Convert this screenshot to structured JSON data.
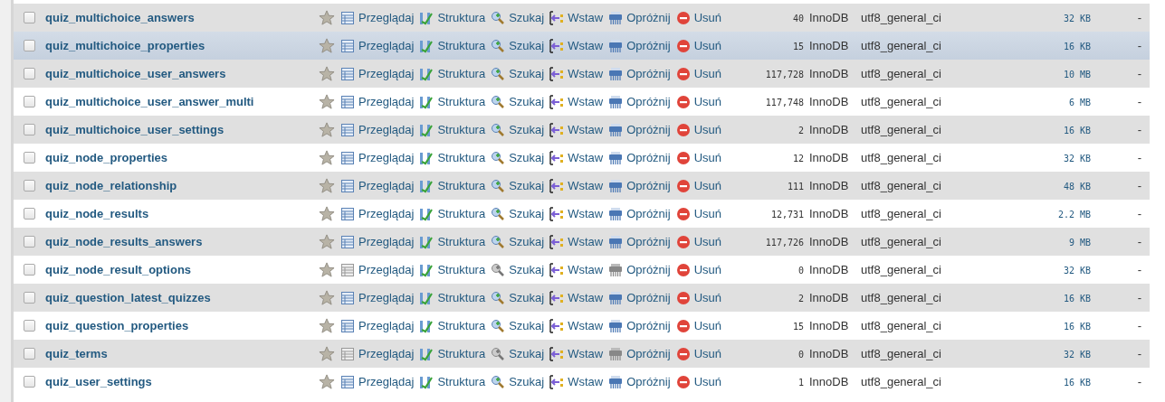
{
  "rows": [
    {
      "name": "quiz_multichoice_answers",
      "checked": false,
      "highlighted": false,
      "actions": [
        {
          "kind": "browse",
          "label": "Przeglądaj",
          "disabled": false
        },
        {
          "kind": "structure",
          "label": "Struktura",
          "disabled": false
        },
        {
          "kind": "search",
          "label": "Szukaj",
          "disabled": false
        },
        {
          "kind": "insert",
          "label": "Wstaw",
          "disabled": false
        },
        {
          "kind": "empty",
          "label": "Opróżnij",
          "disabled": false
        },
        {
          "kind": "drop",
          "label": "Usuń",
          "disabled": false
        }
      ],
      "row_count": "40",
      "engine": "InnoDB",
      "collation": "utf8_general_ci",
      "size": "32",
      "size_unit": "KB",
      "overhead": "-"
    },
    {
      "name": "quiz_multichoice_properties",
      "checked": false,
      "highlighted": true,
      "actions": [
        {
          "kind": "browse",
          "label": "Przeglądaj",
          "disabled": false
        },
        {
          "kind": "structure",
          "label": "Struktura",
          "disabled": false
        },
        {
          "kind": "search",
          "label": "Szukaj",
          "disabled": false
        },
        {
          "kind": "insert",
          "label": "Wstaw",
          "disabled": false
        },
        {
          "kind": "empty",
          "label": "Opróżnij",
          "disabled": false
        },
        {
          "kind": "drop",
          "label": "Usuń",
          "disabled": false
        }
      ],
      "row_count": "15",
      "engine": "InnoDB",
      "collation": "utf8_general_ci",
      "size": "16",
      "size_unit": "KB",
      "overhead": "-"
    },
    {
      "name": "quiz_multichoice_user_answers",
      "checked": false,
      "highlighted": false,
      "actions": [
        {
          "kind": "browse",
          "label": "Przeglądaj",
          "disabled": false
        },
        {
          "kind": "structure",
          "label": "Struktura",
          "disabled": false
        },
        {
          "kind": "search",
          "label": "Szukaj",
          "disabled": false
        },
        {
          "kind": "insert",
          "label": "Wstaw",
          "disabled": false
        },
        {
          "kind": "empty",
          "label": "Opróżnij",
          "disabled": false
        },
        {
          "kind": "drop",
          "label": "Usuń",
          "disabled": false
        }
      ],
      "row_count": "117,728",
      "engine": "InnoDB",
      "collation": "utf8_general_ci",
      "size": "10",
      "size_unit": "MB",
      "overhead": "-"
    },
    {
      "name": "quiz_multichoice_user_answer_multi",
      "checked": false,
      "highlighted": false,
      "actions": [
        {
          "kind": "browse",
          "label": "Przeglądaj",
          "disabled": false
        },
        {
          "kind": "structure",
          "label": "Struktura",
          "disabled": false
        },
        {
          "kind": "search",
          "label": "Szukaj",
          "disabled": false
        },
        {
          "kind": "insert",
          "label": "Wstaw",
          "disabled": false
        },
        {
          "kind": "empty",
          "label": "Opróżnij",
          "disabled": false
        },
        {
          "kind": "drop",
          "label": "Usuń",
          "disabled": false
        }
      ],
      "row_count": "117,748",
      "engine": "InnoDB",
      "collation": "utf8_general_ci",
      "size": "6",
      "size_unit": "MB",
      "overhead": "-"
    },
    {
      "name": "quiz_multichoice_user_settings",
      "checked": false,
      "highlighted": false,
      "actions": [
        {
          "kind": "browse",
          "label": "Przeglądaj",
          "disabled": false
        },
        {
          "kind": "structure",
          "label": "Struktura",
          "disabled": false
        },
        {
          "kind": "search",
          "label": "Szukaj",
          "disabled": false
        },
        {
          "kind": "insert",
          "label": "Wstaw",
          "disabled": false
        },
        {
          "kind": "empty",
          "label": "Opróżnij",
          "disabled": false
        },
        {
          "kind": "drop",
          "label": "Usuń",
          "disabled": false
        }
      ],
      "row_count": "2",
      "engine": "InnoDB",
      "collation": "utf8_general_ci",
      "size": "16",
      "size_unit": "KB",
      "overhead": "-"
    },
    {
      "name": "quiz_node_properties",
      "checked": false,
      "highlighted": false,
      "actions": [
        {
          "kind": "browse",
          "label": "Przeglądaj",
          "disabled": false
        },
        {
          "kind": "structure",
          "label": "Struktura",
          "disabled": false
        },
        {
          "kind": "search",
          "label": "Szukaj",
          "disabled": false
        },
        {
          "kind": "insert",
          "label": "Wstaw",
          "disabled": false
        },
        {
          "kind": "empty",
          "label": "Opróżnij",
          "disabled": false
        },
        {
          "kind": "drop",
          "label": "Usuń",
          "disabled": false
        }
      ],
      "row_count": "12",
      "engine": "InnoDB",
      "collation": "utf8_general_ci",
      "size": "32",
      "size_unit": "KB",
      "overhead": "-"
    },
    {
      "name": "quiz_node_relationship",
      "checked": false,
      "highlighted": false,
      "actions": [
        {
          "kind": "browse",
          "label": "Przeglądaj",
          "disabled": false
        },
        {
          "kind": "structure",
          "label": "Struktura",
          "disabled": false
        },
        {
          "kind": "search",
          "label": "Szukaj",
          "disabled": false
        },
        {
          "kind": "insert",
          "label": "Wstaw",
          "disabled": false
        },
        {
          "kind": "empty",
          "label": "Opróżnij",
          "disabled": false
        },
        {
          "kind": "drop",
          "label": "Usuń",
          "disabled": false
        }
      ],
      "row_count": "111",
      "engine": "InnoDB",
      "collation": "utf8_general_ci",
      "size": "48",
      "size_unit": "KB",
      "overhead": "-"
    },
    {
      "name": "quiz_node_results",
      "checked": false,
      "highlighted": false,
      "actions": [
        {
          "kind": "browse",
          "label": "Przeglądaj",
          "disabled": false
        },
        {
          "kind": "structure",
          "label": "Struktura",
          "disabled": false
        },
        {
          "kind": "search",
          "label": "Szukaj",
          "disabled": false
        },
        {
          "kind": "insert",
          "label": "Wstaw",
          "disabled": false
        },
        {
          "kind": "empty",
          "label": "Opróżnij",
          "disabled": false
        },
        {
          "kind": "drop",
          "label": "Usuń",
          "disabled": false
        }
      ],
      "row_count": "12,731",
      "engine": "InnoDB",
      "collation": "utf8_general_ci",
      "size": "2.2",
      "size_unit": "MB",
      "overhead": "-"
    },
    {
      "name": "quiz_node_results_answers",
      "checked": false,
      "highlighted": false,
      "actions": [
        {
          "kind": "browse",
          "label": "Przeglądaj",
          "disabled": false
        },
        {
          "kind": "structure",
          "label": "Struktura",
          "disabled": false
        },
        {
          "kind": "search",
          "label": "Szukaj",
          "disabled": false
        },
        {
          "kind": "insert",
          "label": "Wstaw",
          "disabled": false
        },
        {
          "kind": "empty",
          "label": "Opróżnij",
          "disabled": false
        },
        {
          "kind": "drop",
          "label": "Usuń",
          "disabled": false
        }
      ],
      "row_count": "117,726",
      "engine": "InnoDB",
      "collation": "utf8_general_ci",
      "size": "9",
      "size_unit": "MB",
      "overhead": "-"
    },
    {
      "name": "quiz_node_result_options",
      "checked": false,
      "highlighted": false,
      "actions": [
        {
          "kind": "browse",
          "label": "Przeglądaj",
          "disabled": true
        },
        {
          "kind": "structure",
          "label": "Struktura",
          "disabled": false
        },
        {
          "kind": "search",
          "label": "Szukaj",
          "disabled": true
        },
        {
          "kind": "insert",
          "label": "Wstaw",
          "disabled": false
        },
        {
          "kind": "empty",
          "label": "Opróżnij",
          "disabled": true
        },
        {
          "kind": "drop",
          "label": "Usuń",
          "disabled": false
        }
      ],
      "row_count": "0",
      "engine": "InnoDB",
      "collation": "utf8_general_ci",
      "size": "32",
      "size_unit": "KB",
      "overhead": "-"
    },
    {
      "name": "quiz_question_latest_quizzes",
      "checked": false,
      "highlighted": false,
      "actions": [
        {
          "kind": "browse",
          "label": "Przeglądaj",
          "disabled": false
        },
        {
          "kind": "structure",
          "label": "Struktura",
          "disabled": false
        },
        {
          "kind": "search",
          "label": "Szukaj",
          "disabled": false
        },
        {
          "kind": "insert",
          "label": "Wstaw",
          "disabled": false
        },
        {
          "kind": "empty",
          "label": "Opróżnij",
          "disabled": false
        },
        {
          "kind": "drop",
          "label": "Usuń",
          "disabled": false
        }
      ],
      "row_count": "2",
      "engine": "InnoDB",
      "collation": "utf8_general_ci",
      "size": "16",
      "size_unit": "KB",
      "overhead": "-"
    },
    {
      "name": "quiz_question_properties",
      "checked": false,
      "highlighted": false,
      "actions": [
        {
          "kind": "browse",
          "label": "Przeglądaj",
          "disabled": false
        },
        {
          "kind": "structure",
          "label": "Struktura",
          "disabled": false
        },
        {
          "kind": "search",
          "label": "Szukaj",
          "disabled": false
        },
        {
          "kind": "insert",
          "label": "Wstaw",
          "disabled": false
        },
        {
          "kind": "empty",
          "label": "Opróżnij",
          "disabled": false
        },
        {
          "kind": "drop",
          "label": "Usuń",
          "disabled": false
        }
      ],
      "row_count": "15",
      "engine": "InnoDB",
      "collation": "utf8_general_ci",
      "size": "16",
      "size_unit": "KB",
      "overhead": "-"
    },
    {
      "name": "quiz_terms",
      "checked": false,
      "highlighted": false,
      "actions": [
        {
          "kind": "browse",
          "label": "Przeglądaj",
          "disabled": true
        },
        {
          "kind": "structure",
          "label": "Struktura",
          "disabled": false
        },
        {
          "kind": "search",
          "label": "Szukaj",
          "disabled": true
        },
        {
          "kind": "insert",
          "label": "Wstaw",
          "disabled": false
        },
        {
          "kind": "empty",
          "label": "Opróżnij",
          "disabled": true
        },
        {
          "kind": "drop",
          "label": "Usuń",
          "disabled": false
        }
      ],
      "row_count": "0",
      "engine": "InnoDB",
      "collation": "utf8_general_ci",
      "size": "32",
      "size_unit": "KB",
      "overhead": "-"
    },
    {
      "name": "quiz_user_settings",
      "checked": false,
      "highlighted": false,
      "actions": [
        {
          "kind": "browse",
          "label": "Przeglądaj",
          "disabled": false
        },
        {
          "kind": "structure",
          "label": "Struktura",
          "disabled": false
        },
        {
          "kind": "search",
          "label": "Szukaj",
          "disabled": false
        },
        {
          "kind": "insert",
          "label": "Wstaw",
          "disabled": false
        },
        {
          "kind": "empty",
          "label": "Opróżnij",
          "disabled": false
        },
        {
          "kind": "drop",
          "label": "Usuń",
          "disabled": false
        }
      ],
      "row_count": "1",
      "engine": "InnoDB",
      "collation": "utf8_general_ci",
      "size": "16",
      "size_unit": "KB",
      "overhead": "-"
    }
  ]
}
